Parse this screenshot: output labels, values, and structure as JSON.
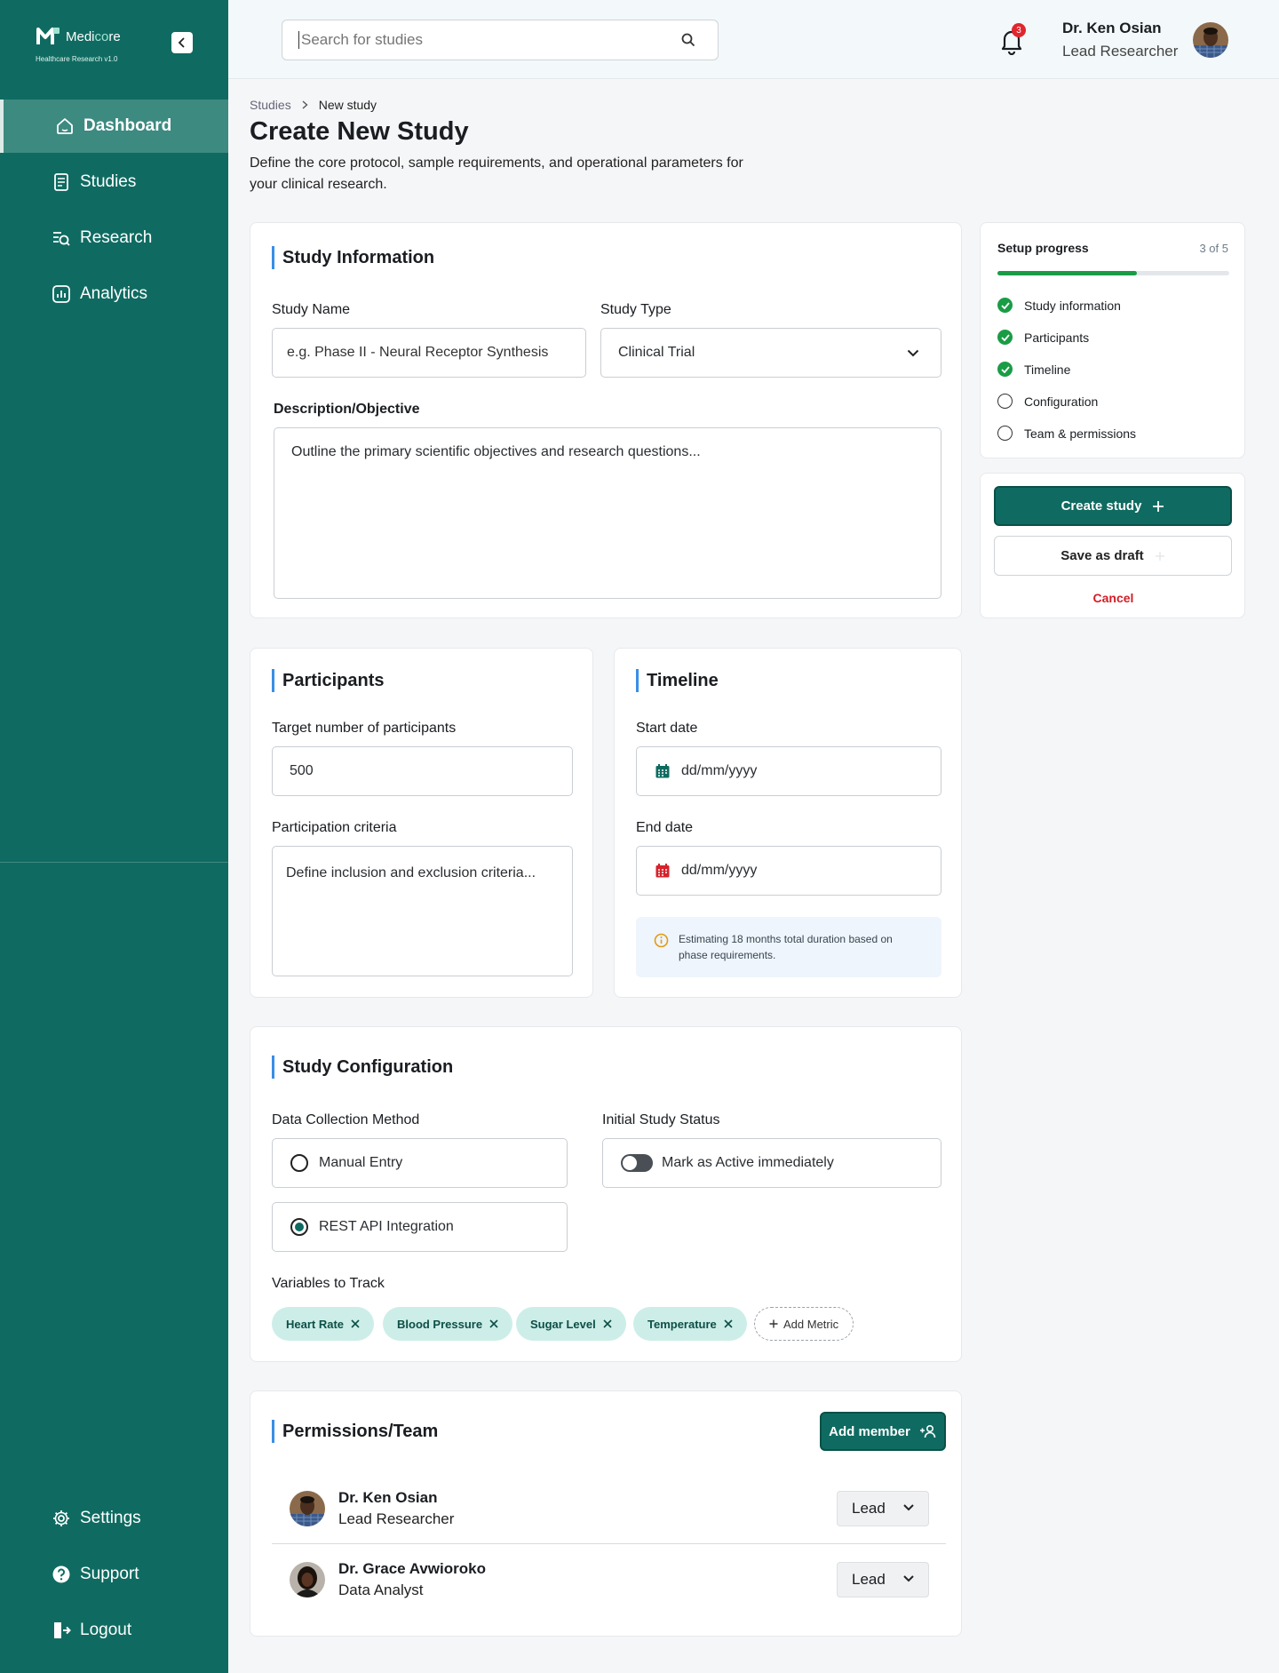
{
  "brand": {
    "name_main": "Medi",
    "name_accent": "co",
    "name_tail": "re",
    "subtitle": "Healthcare Research v1.0",
    "primary_color": "#0f6b61",
    "accent_color": "#3a8ee6"
  },
  "sidebar": {
    "items": [
      {
        "label": "Dashboard",
        "icon": "home-icon"
      },
      {
        "label": "Studies",
        "icon": "document-icon"
      },
      {
        "label": "Research",
        "icon": "list-search-icon"
      },
      {
        "label": "Analytics",
        "icon": "chart-icon"
      }
    ],
    "bottom_items": [
      {
        "label": "Settings",
        "icon": "gear-icon"
      },
      {
        "label": "Support",
        "icon": "help-icon"
      },
      {
        "label": "Logout",
        "icon": "logout-icon"
      }
    ]
  },
  "header": {
    "search_placeholder": "Search for studies",
    "notification_count": "3",
    "user_name": "Dr. Ken Osian",
    "user_role": "Lead Researcher"
  },
  "breadcrumb": {
    "parent": "Studies",
    "current": "New study"
  },
  "page": {
    "title": "Create New Study",
    "subtitle": "Define the core protocol, sample requirements, and operational parameters for your clinical research."
  },
  "study_info": {
    "title": "Study Information",
    "name_label": "Study Name",
    "name_placeholder": "e.g. Phase II - Neural Receptor Synthesis",
    "type_label": "Study Type",
    "type_value": "Clinical Trial",
    "desc_label": "Description/Objective",
    "desc_placeholder": "Outline the primary scientific objectives and research questions..."
  },
  "progress": {
    "title": "Setup progress",
    "count": "3 of 5",
    "fraction": 0.6,
    "steps": [
      {
        "label": "Study information",
        "done": true
      },
      {
        "label": "Participants",
        "done": true
      },
      {
        "label": "Timeline",
        "done": true
      },
      {
        "label": "Configuration",
        "done": false
      },
      {
        "label": "Team & permissions",
        "done": false
      }
    ]
  },
  "actions": {
    "create": "Create study",
    "draft": "Save as draft",
    "cancel": "Cancel"
  },
  "participants": {
    "title": "Participants",
    "target_label": "Target number of participants",
    "target_value": "500",
    "criteria_label": "Participation criteria",
    "criteria_placeholder": "Define inclusion and exclusion criteria..."
  },
  "timeline": {
    "title": "Timeline",
    "start_label": "Start date",
    "start_placeholder": "dd/mm/yyyy",
    "end_label": "End date",
    "end_placeholder": "dd/mm/yyyy",
    "info": "Estimating 18 months total duration based on phase requirements."
  },
  "config": {
    "title": "Study Configuration",
    "method_label": "Data Collection Method",
    "method_options": [
      {
        "label": "Manual Entry",
        "selected": false
      },
      {
        "label": "REST API Integration",
        "selected": true
      }
    ],
    "status_label": "Initial Study Status",
    "status_toggle": "Mark as Active immediately",
    "variables_label": "Variables to Track",
    "variables": [
      "Heart Rate",
      "Blood Pressure",
      "Sugar Level",
      "Temperature"
    ],
    "add_metric": "Add Metric"
  },
  "team": {
    "title": "Permissions/Team",
    "add_member": "Add member",
    "members": [
      {
        "name": "Dr. Ken Osian",
        "role": "Lead Researcher",
        "permission": "Lead"
      },
      {
        "name": "Dr. Grace Avwioroko",
        "role": "Data Analyst",
        "permission": "Lead"
      }
    ]
  }
}
